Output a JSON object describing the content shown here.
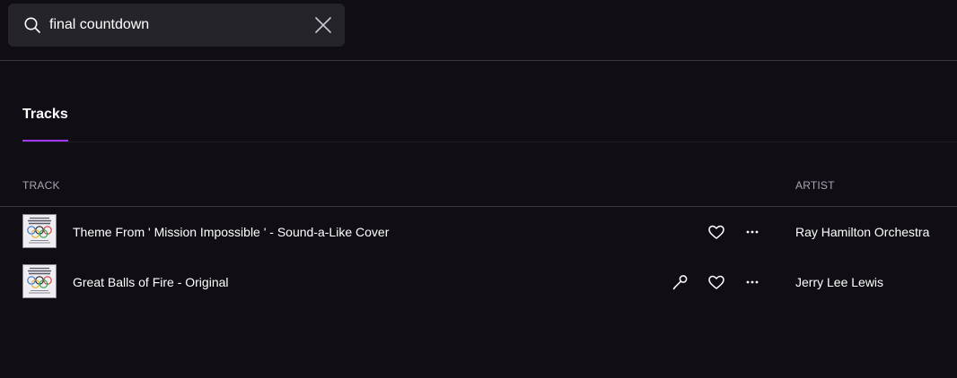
{
  "search": {
    "value": "final countdown",
    "icon": "search-icon",
    "clear_icon": "close-icon"
  },
  "tabs": [
    {
      "label": "Tracks",
      "active": true
    }
  ],
  "accent_color": "#a238ff",
  "table": {
    "columns": {
      "track": "TRACK",
      "artist": "ARTIST"
    },
    "rows": [
      {
        "title": "Theme From ' Mission Impossible ' - Sound-a-Like Cover",
        "artist": "Ray Hamilton Orchestra",
        "has_lyrics": false
      },
      {
        "title": "Great Balls of Fire - Original",
        "artist": "Jerry Lee Lewis",
        "has_lyrics": true
      }
    ]
  }
}
